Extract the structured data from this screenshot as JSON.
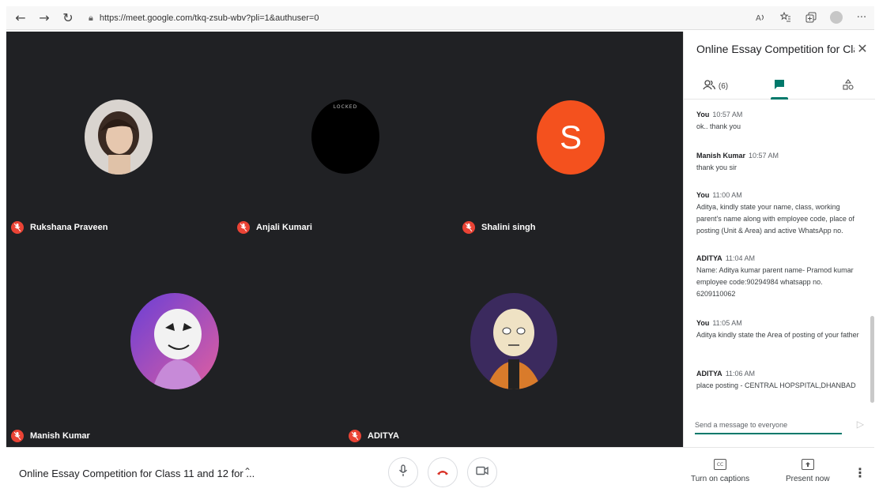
{
  "browser": {
    "url": "https://meet.google.com/tkq-zsub-wbv?pli=1&authuser=0",
    "more_label": "···"
  },
  "participants": [
    {
      "name": "Rukshana Praveen"
    },
    {
      "name": "Anjali Kumari",
      "avatar_overlay": "LOCKED"
    },
    {
      "name": "Shalini singh",
      "initial": "S"
    },
    {
      "name": "Manish Kumar"
    },
    {
      "name": "ADITYA"
    }
  ],
  "panel": {
    "title": "Online Essay Competition for Cla...",
    "people_count": "(6)",
    "messages": [
      {
        "sender": "You",
        "time": "10:57 AM",
        "text": "ok.. thank you"
      },
      {
        "sender": "Manish Kumar",
        "time": "10:57 AM",
        "text": "thank you sir"
      },
      {
        "sender": "You",
        "time": "11:00 AM",
        "text": "Aditya, kindly state your name, class, working parent's name along with employee code, place of posting (Unit & Area) and active WhatsApp no."
      },
      {
        "sender": "ADITYA",
        "time": "11:04 AM",
        "text": "Name: Aditya kumar parent name- Pramod kumar employee code:90294984  whatsapp no. 6209110062"
      },
      {
        "sender": "You",
        "time": "11:05 AM",
        "text": "Aditya kindly state the Area of posting of your father"
      },
      {
        "sender": "ADITYA",
        "time": "11:06 AM",
        "text": "place posting - CENTRAL HOPSPITAL,DHANBAD"
      }
    ],
    "input_placeholder": "Send a message to everyone"
  },
  "bottom": {
    "meeting_title": "Online Essay Competition for Class 11 and 12 for ...",
    "captions_label": "Turn on captions",
    "captions_icon": "CC",
    "present_label": "Present now"
  },
  "colors": {
    "accent": "#00796b",
    "mic_off": "#ea4335",
    "shalini_avatar": "#f4511e",
    "video_bg": "#202124"
  }
}
